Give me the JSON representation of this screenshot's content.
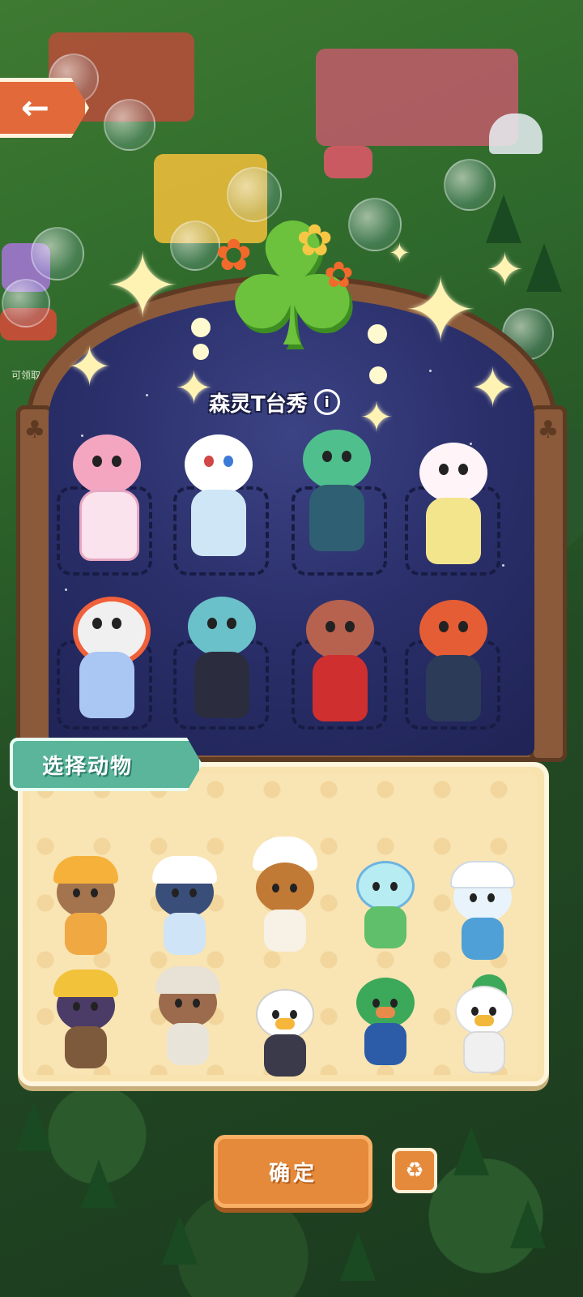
{
  "nav": {
    "back_label": "",
    "back_icon": "back-arrow-icon"
  },
  "world": {
    "side_label": "可领取"
  },
  "stage": {
    "title": "森灵T台秀",
    "info_icon": "info-icon",
    "costumes": [
      {
        "name": "pink-bear-lolita",
        "colors": [
          "#f4a6c1",
          "#fbe3ee"
        ]
      },
      {
        "name": "ski-bird",
        "colors": [
          "#ffffff",
          "#cfe6f7"
        ]
      },
      {
        "name": "green-lion-dancer",
        "colors": [
          "#4fc08d",
          "#2f5f72"
        ]
      },
      {
        "name": "rainbow-unicorn",
        "colors": [
          "#fff4f8",
          "#f3e58b"
        ]
      },
      {
        "name": "opera-panda",
        "colors": [
          "#f0f0f0",
          "#a9c7f2"
        ]
      },
      {
        "name": "cool-ram",
        "colors": [
          "#6bc1c9",
          "#2b2d3e"
        ]
      },
      {
        "name": "royal-deer",
        "colors": [
          "#b7624f",
          "#cf2f2f"
        ]
      },
      {
        "name": "red-fox",
        "colors": [
          "#e55d35",
          "#2c3b58"
        ]
      }
    ]
  },
  "select": {
    "tab_label": "选择动物",
    "animals": [
      {
        "name": "dog-yellow-hat",
        "colors": [
          "#a4744e",
          "#f6b13a",
          "#f0a843"
        ]
      },
      {
        "name": "penguin-beanie",
        "colors": [
          "#ffffff",
          "#3a4e7a",
          "#cfe4f6"
        ]
      },
      {
        "name": "capybara-chef",
        "colors": [
          "#c07a36",
          "#f7f1e6",
          "#ffffff"
        ]
      },
      {
        "name": "fishbowl-frog",
        "colors": [
          "#5fbf6a",
          "#6db3e0",
          "#b7ecf2"
        ]
      },
      {
        "name": "seal-sailor",
        "colors": [
          "#e8f3fb",
          "#ffffff",
          "#4ea0d6"
        ]
      },
      {
        "name": "mole-miner",
        "colors": [
          "#4b3b67",
          "#7e5a3d",
          "#f2c23a"
        ]
      },
      {
        "name": "walrus-bedhead",
        "colors": [
          "#9c6b4d",
          "#e7e2d5",
          "#e9e4da"
        ]
      },
      {
        "name": "eagle-suit",
        "colors": [
          "#ffffff",
          "#3a3a4a",
          "#e7e7e7"
        ]
      },
      {
        "name": "peacock",
        "colors": [
          "#3ca85a",
          "#2c5ca8",
          "#2ba25a"
        ]
      },
      {
        "name": "crane",
        "colors": [
          "#ffffff",
          "#f0f0f0",
          "#e63c3c"
        ]
      }
    ]
  },
  "actions": {
    "confirm_label": "确定",
    "clear_icon": "broom-icon"
  },
  "colors": {
    "accent": "#e58a3a",
    "stage_bg": "#2a2f6a",
    "panel_bg": "#f8e2ad",
    "tab": "#5ab59a"
  }
}
